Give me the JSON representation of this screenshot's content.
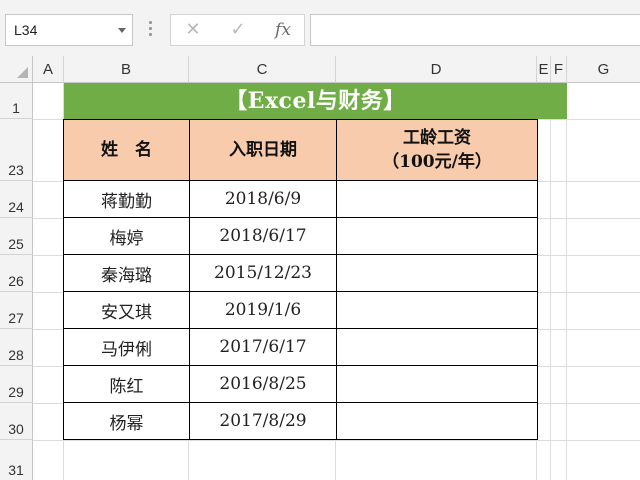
{
  "name_box": {
    "value": "L34"
  },
  "formula_bar": {
    "cancel_icon": "x-icon",
    "enter_icon": "check-icon",
    "function_label": "fx",
    "content": ""
  },
  "columns": [
    "A",
    "B",
    "C",
    "D",
    "E",
    "F",
    "G"
  ],
  "rows": [
    "1",
    "23",
    "24",
    "25",
    "26",
    "27",
    "28",
    "29",
    "30",
    "31"
  ],
  "sheet": {
    "title": "【Excel与财务】",
    "headers": {
      "name": "姓　名",
      "hire_date": "入职日期",
      "seniority_pay_line1": "工龄工资",
      "seniority_pay_line2": "（100元/年）"
    },
    "records": [
      {
        "name": "蒋勤勤",
        "hire_date": "2018/6/9",
        "seniority_pay": ""
      },
      {
        "name": "梅婷",
        "hire_date": "2018/6/17",
        "seniority_pay": ""
      },
      {
        "name": "秦海璐",
        "hire_date": "2015/12/23",
        "seniority_pay": ""
      },
      {
        "name": "安又琪",
        "hire_date": "2019/1/6",
        "seniority_pay": ""
      },
      {
        "name": "马伊俐",
        "hire_date": "2017/6/17",
        "seniority_pay": ""
      },
      {
        "name": "陈红",
        "hire_date": "2016/8/25",
        "seniority_pay": ""
      },
      {
        "name": "杨幂",
        "hire_date": "2017/8/29",
        "seniority_pay": ""
      }
    ]
  },
  "colors": {
    "title_fill": "#70ad47",
    "header_fill": "#f8cbad",
    "title_text": "#ffffff"
  }
}
